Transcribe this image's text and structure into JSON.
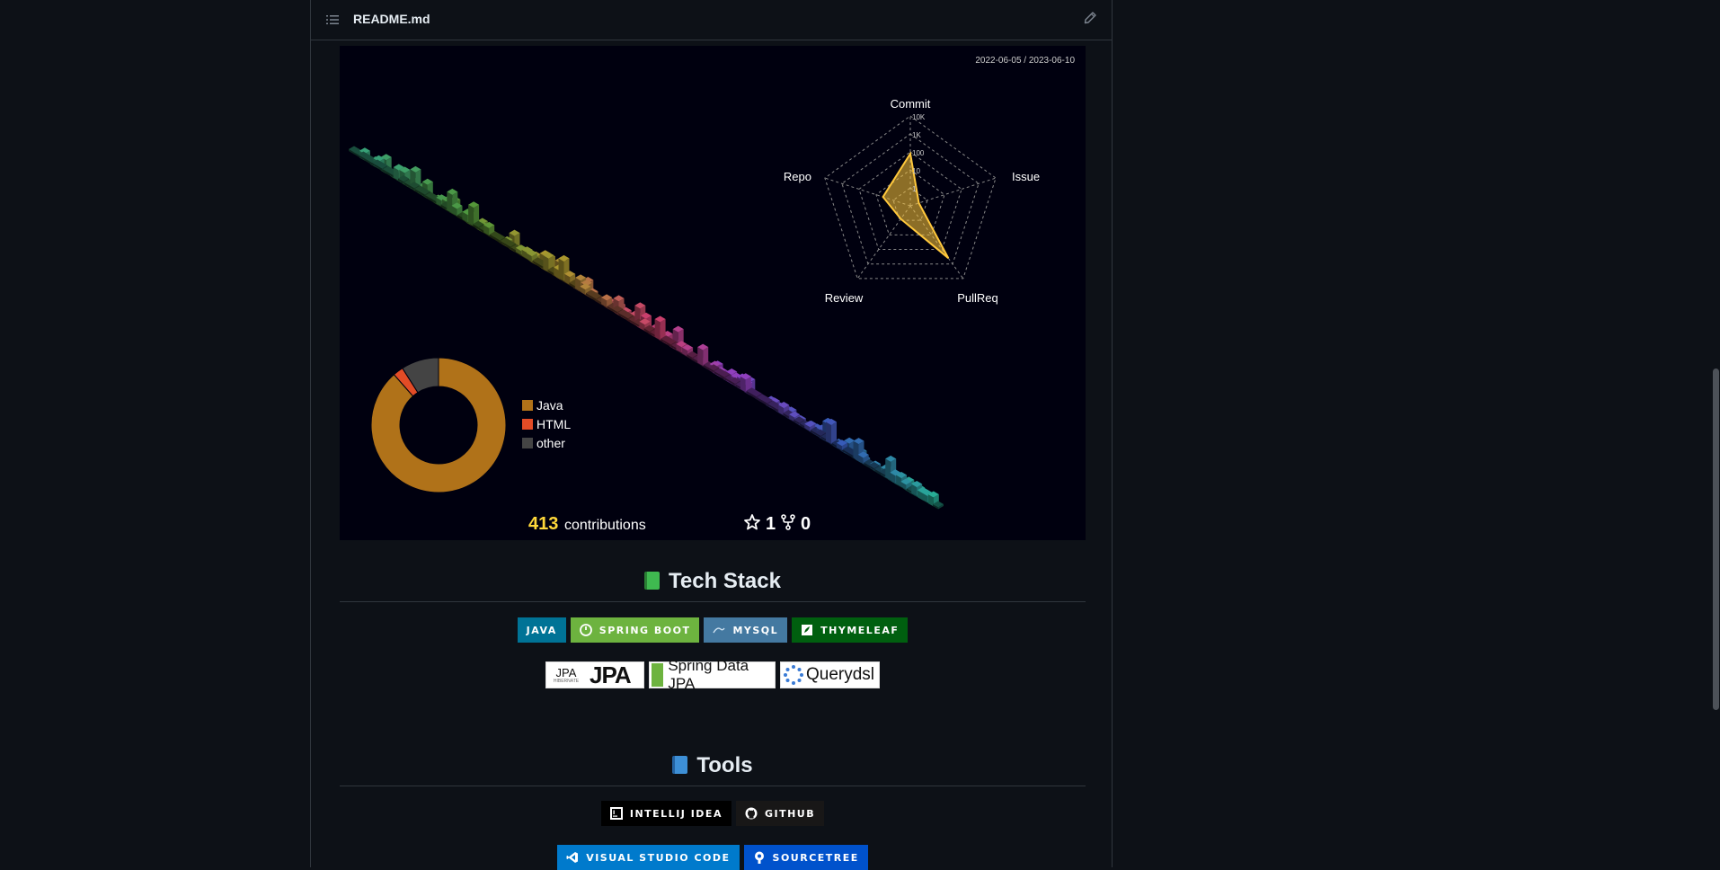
{
  "file_header": {
    "name": "README.md",
    "outline_icon": "list-icon",
    "edit_icon": "pencil-icon"
  },
  "profile": {
    "period": "2022-06-05 / 2023-06-10",
    "radar": {
      "labels": {
        "commit": "Commit",
        "issue": "Issue",
        "pullreq": "PullReq",
        "review": "Review",
        "repo": "Repo"
      },
      "ticks": [
        "10K",
        "1K",
        "100",
        "10",
        "1"
      ],
      "color": "#ffc83c"
    },
    "languages": [
      {
        "name": "Java",
        "color": "#b07219"
      },
      {
        "name": "HTML",
        "color": "#e34c26"
      },
      {
        "name": "other",
        "color": "#444444"
      }
    ],
    "contributions": {
      "count": "413",
      "label": "contributions"
    },
    "stars": "1",
    "forks": "0"
  },
  "tech_stack": {
    "title": "Tech Stack",
    "badges": [
      {
        "label": "JAVA",
        "color": "#007396"
      },
      {
        "label": "SPRING BOOT",
        "color": "#6db33f"
      },
      {
        "label": "MYSQL",
        "color": "#4479a1"
      },
      {
        "label": "THYMELEAF",
        "color": "#005f0f"
      }
    ],
    "logos": [
      {
        "text": "JPA",
        "small": "JPA",
        "sub": "HIBERNATE"
      },
      {
        "text": "Spring Data JPA"
      },
      {
        "text": "Querydsl"
      }
    ]
  },
  "tools": {
    "title": "Tools",
    "badges_row1": [
      {
        "label": "INTELLIJ IDEA",
        "color": "#000000"
      },
      {
        "label": "GITHUB",
        "color": "#181717"
      }
    ],
    "badges_row2": [
      {
        "label": "VISUAL STUDIO CODE",
        "color": "#007acc"
      },
      {
        "label": "SOURCETREE",
        "color": "#0052cc"
      }
    ]
  }
}
